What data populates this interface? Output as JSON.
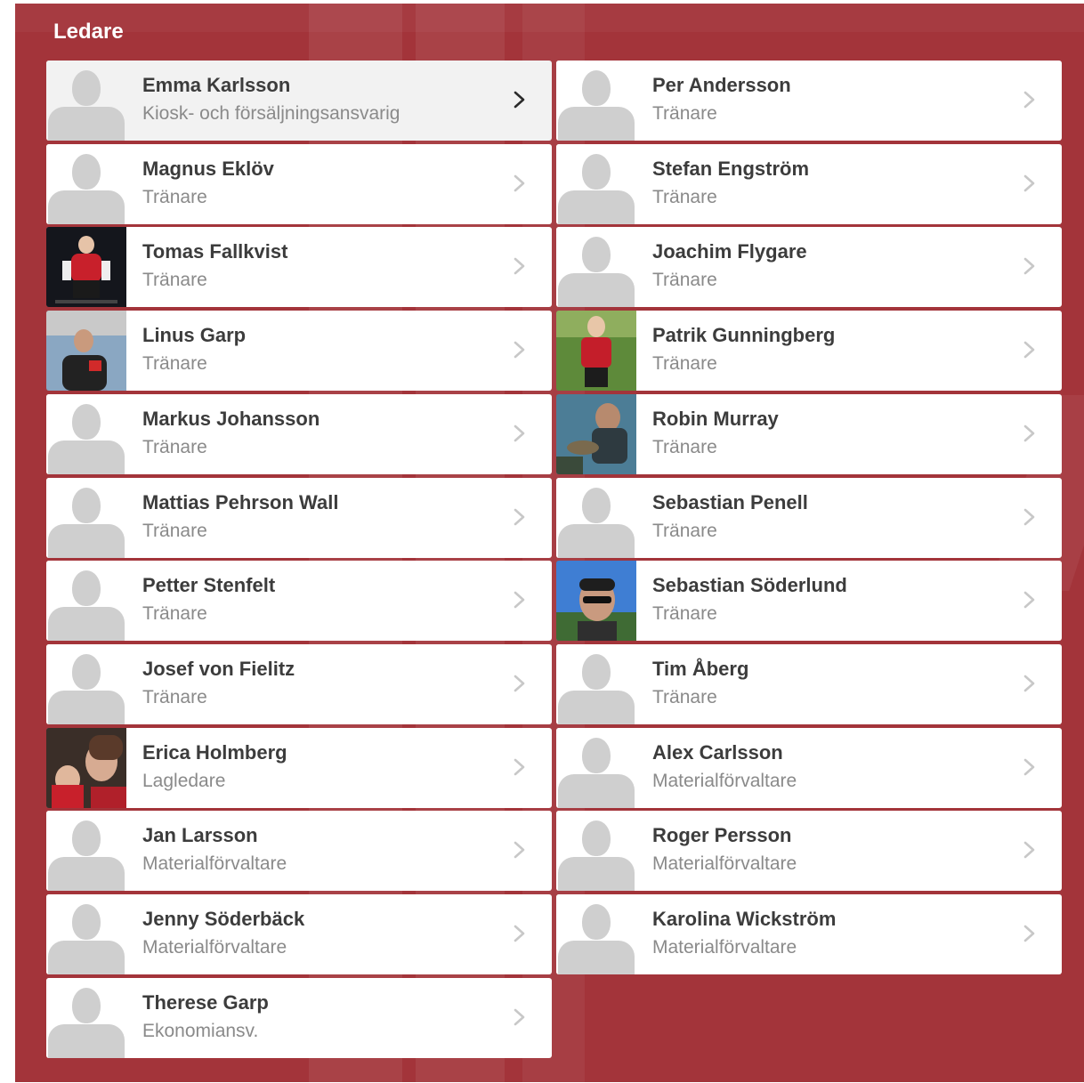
{
  "section": {
    "title": "Ledare"
  },
  "leaders": [
    {
      "name": "Emma Karlsson",
      "role": "Kiosk- och försäljningsansvarig",
      "avatar": "placeholder",
      "highlighted": true
    },
    {
      "name": "Per Andersson",
      "role": "Tränare",
      "avatar": "placeholder"
    },
    {
      "name": "Magnus Eklöv",
      "role": "Tränare",
      "avatar": "placeholder"
    },
    {
      "name": "Stefan Engström",
      "role": "Tränare",
      "avatar": "placeholder"
    },
    {
      "name": "Tomas Fallkvist",
      "role": "Tränare",
      "avatar": "photo-hockey-player"
    },
    {
      "name": "Joachim Flygare",
      "role": "Tränare",
      "avatar": "placeholder"
    },
    {
      "name": "Linus Garp",
      "role": "Tränare",
      "avatar": "photo-rink-portrait"
    },
    {
      "name": "Patrik Gunningberg",
      "role": "Tränare",
      "avatar": "photo-red-shirt-grass"
    },
    {
      "name": "Markus Johansson",
      "role": "Tränare",
      "avatar": "placeholder"
    },
    {
      "name": "Robin Murray",
      "role": "Tränare",
      "avatar": "photo-outdoor-fish"
    },
    {
      "name": "Mattias Pehrson Wall",
      "role": "Tränare",
      "avatar": "placeholder"
    },
    {
      "name": "Sebastian Penell",
      "role": "Tränare",
      "avatar": "placeholder"
    },
    {
      "name": "Petter Stenfelt",
      "role": "Tränare",
      "avatar": "placeholder"
    },
    {
      "name": "Sebastian Söderlund",
      "role": "Tränare",
      "avatar": "photo-cap-sunglasses"
    },
    {
      "name": "Josef von Fielitz",
      "role": "Tränare",
      "avatar": "placeholder"
    },
    {
      "name": "Tim Åberg",
      "role": "Tränare",
      "avatar": "placeholder"
    },
    {
      "name": "Erica Holmberg",
      "role": "Lagledare",
      "avatar": "photo-selfie"
    },
    {
      "name": "Alex Carlsson",
      "role": "Materialförvaltare",
      "avatar": "placeholder"
    },
    {
      "name": "Jan Larsson",
      "role": "Materialförvaltare",
      "avatar": "placeholder"
    },
    {
      "name": "Roger Persson",
      "role": "Materialförvaltare",
      "avatar": "placeholder"
    },
    {
      "name": "Jenny Söderbäck",
      "role": "Materialförvaltare",
      "avatar": "placeholder"
    },
    {
      "name": "Karolina Wickström",
      "role": "Materialförvaltare",
      "avatar": "placeholder"
    },
    {
      "name": "Therese Garp",
      "role": "Ekonomiansv.",
      "avatar": "placeholder"
    }
  ],
  "icons": {
    "chevron": "chevron-right-icon",
    "placeholder": "person-silhouette-icon"
  },
  "colors": {
    "panel": "#a3343a",
    "name_text": "#3c3c3c",
    "role_text": "#8a8a8a",
    "chevron_active": "#2b2b2b",
    "chevron_inactive": "#c8c8c8"
  }
}
